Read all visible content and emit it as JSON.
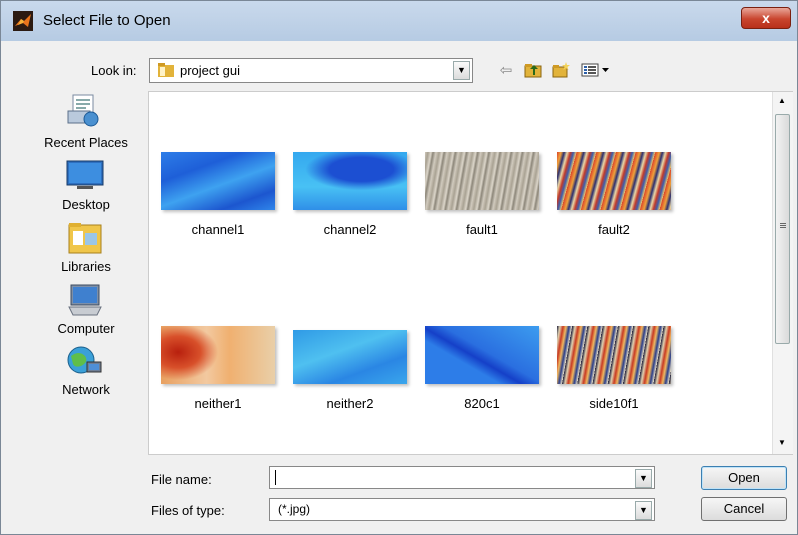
{
  "window": {
    "title": "Select File to Open",
    "close_glyph": "x"
  },
  "toolbar": {
    "look_in_label": "Look in:",
    "look_in_value": "project gui",
    "icons": [
      "back-icon",
      "up-folder-icon",
      "new-folder-icon",
      "view-menu-icon"
    ]
  },
  "places": [
    {
      "label": "Recent Places",
      "icon": "recent-places-icon"
    },
    {
      "label": "Desktop",
      "icon": "desktop-icon"
    },
    {
      "label": "Libraries",
      "icon": "libraries-icon"
    },
    {
      "label": "Computer",
      "icon": "computer-icon"
    },
    {
      "label": "Network",
      "icon": "network-icon"
    }
  ],
  "files": [
    {
      "name": "channel1"
    },
    {
      "name": "channel2"
    },
    {
      "name": "fault1"
    },
    {
      "name": "fault2"
    },
    {
      "name": "neither1"
    },
    {
      "name": "neither2"
    },
    {
      "name": "820c1"
    },
    {
      "name": "side10f1"
    }
  ],
  "form": {
    "file_name_label": "File name:",
    "file_name_value": "",
    "file_type_label": "Files of type:",
    "file_type_value": "(*.jpg)",
    "open_label": "Open",
    "cancel_label": "Cancel"
  }
}
